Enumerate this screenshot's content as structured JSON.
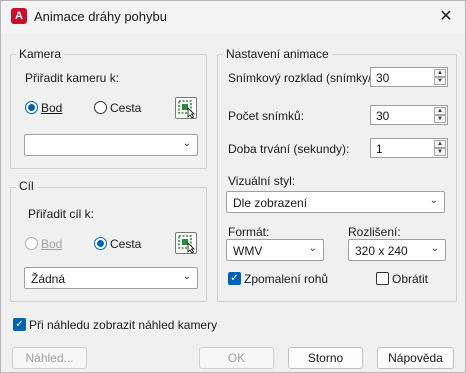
{
  "window": {
    "title": "Animace dráhy pohybu",
    "app_icon_letter": "A",
    "close_glyph": "✕"
  },
  "camera": {
    "legend": "Kamera",
    "assign_label": "Přiřadit kameru k:",
    "radio_point": "Bod",
    "radio_path": "Cesta",
    "combo_value": ""
  },
  "target": {
    "legend": "Cíl",
    "assign_label": "Přiřadit cíl k:",
    "radio_point": "Bod",
    "radio_path": "Cesta",
    "combo_value": "Žádná"
  },
  "animation": {
    "legend": "Nastavení animace",
    "frame_rate_label": "Snímkový rozklad (snímky/s):",
    "frame_rate_value": "30",
    "frames_label": "Počet snímků:",
    "frames_value": "30",
    "duration_label": "Doba trvání (sekundy):",
    "duration_value": "1",
    "visual_style_label": "Vizuální styl:",
    "visual_style_value": "Dle zobrazení",
    "format_label": "Formát:",
    "format_value": "WMV",
    "resolution_label": "Rozlišení:",
    "resolution_value": "320 x 240",
    "corner_decel_label": "Zpomalení rohů",
    "reverse_label": "Obrátit"
  },
  "preview_checkbox_label": "Při náhledu zobrazit náhled kamery",
  "buttons": {
    "preview": "Náhled...",
    "ok": "OK",
    "cancel": "Storno",
    "help": "Nápověda"
  },
  "colors": {
    "accent": "#0063b1",
    "app_icon": "#c8102e"
  }
}
